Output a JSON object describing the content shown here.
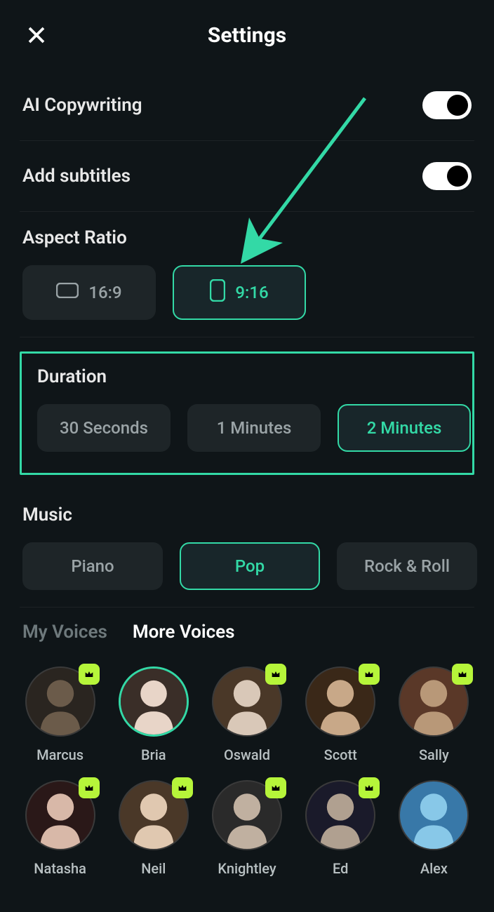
{
  "header": {
    "title": "Settings"
  },
  "toggles": {
    "ai_copywriting": {
      "label": "AI Copywriting",
      "on": true
    },
    "subtitles": {
      "label": "Add subtitles",
      "on": true
    }
  },
  "aspect_ratio": {
    "label": "Aspect Ratio",
    "options": [
      "16:9",
      "9:16"
    ],
    "selected": "9:16"
  },
  "duration": {
    "label": "Duration",
    "options": [
      "30 Seconds",
      "1 Minutes",
      "2 Minutes"
    ],
    "selected": "2 Minutes"
  },
  "music": {
    "label": "Music",
    "options": [
      "Piano",
      "Pop",
      "Rock & Roll"
    ],
    "selected": "Pop"
  },
  "voices": {
    "tabs": {
      "my": "My Voices",
      "more": "More Voices",
      "active": "more"
    },
    "selected": "Bria",
    "items": [
      {
        "name": "Marcus",
        "premium": true
      },
      {
        "name": "Bria",
        "premium": false
      },
      {
        "name": "Oswald",
        "premium": true
      },
      {
        "name": "Scott",
        "premium": true
      },
      {
        "name": "Sally",
        "premium": true
      },
      {
        "name": "Natasha",
        "premium": true
      },
      {
        "name": "Neil",
        "premium": true
      },
      {
        "name": "Knightley",
        "premium": true
      },
      {
        "name": "Ed",
        "premium": true
      },
      {
        "name": "Alex",
        "premium": false
      }
    ]
  },
  "colors": {
    "accent": "#33d9a6",
    "badge": "#b6f53a"
  }
}
